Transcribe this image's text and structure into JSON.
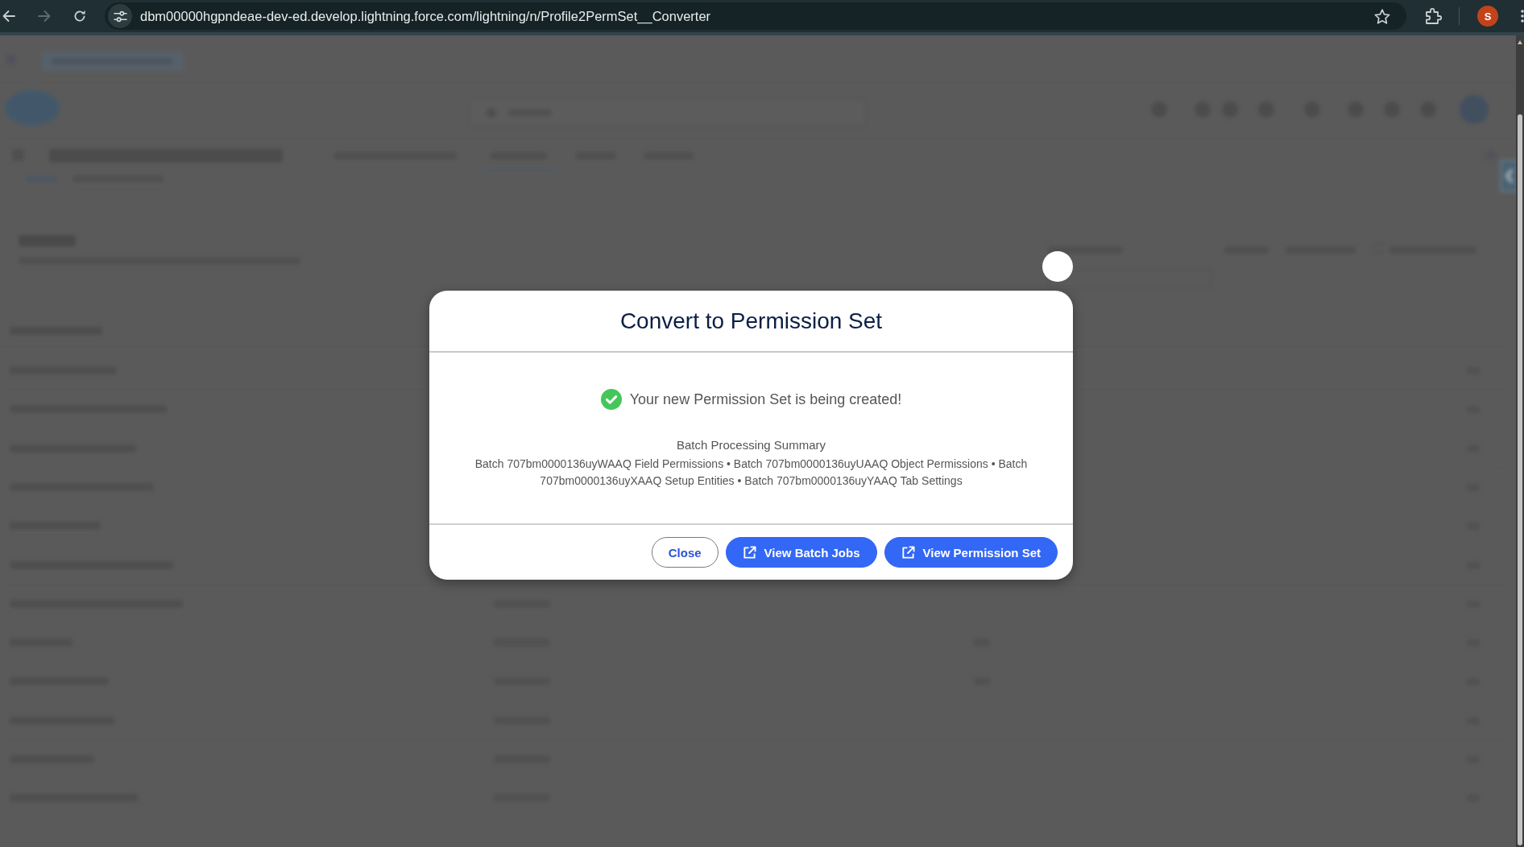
{
  "browser": {
    "nav_buttons": [
      {
        "kind": "back",
        "disabled": false
      },
      {
        "kind": "forward",
        "disabled": true
      },
      {
        "kind": "reload",
        "disabled": false
      }
    ],
    "url": "dbm00000hgpndeae-dev-ed.develop.lightning.force.com/lightning/n/Profile2PermSet__Converter",
    "profile_initial": "S"
  },
  "modal": {
    "title": "Convert to Permission Set",
    "status": {
      "kind": "success",
      "message": "Your new Permission Set is being created!"
    },
    "summary_title": "Batch Processing Summary",
    "summary": "Batch 707bm0000136uyWAAQ Field Permissions • Batch 707bm0000136uyUAAQ Object Permissions • Batch 707bm0000136uyXAAQ Setup Entities • Batch 707bm0000136uyYAAQ Tab Settings",
    "buttons": [
      {
        "label": "Close",
        "kind": "neutral"
      },
      {
        "label": "View Batch Jobs",
        "kind": "brand"
      },
      {
        "label": "View Permission Set",
        "kind": "brand"
      }
    ]
  }
}
